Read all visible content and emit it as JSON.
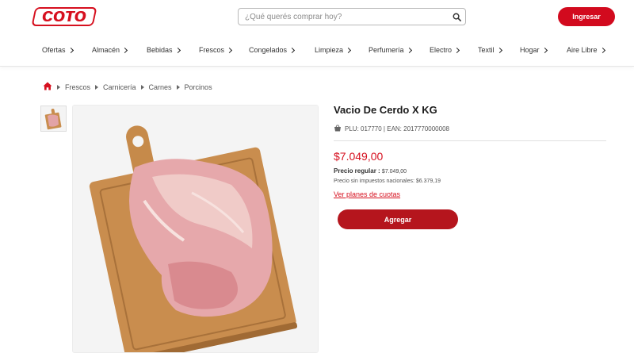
{
  "header": {
    "logo_text": "COTO",
    "search_placeholder": "¿Qué querés comprar hoy?",
    "login_label": "Ingresar",
    "brand_color": "#d6101f"
  },
  "nav": {
    "items": [
      {
        "label": "Ofertas"
      },
      {
        "label": "Almacén"
      },
      {
        "label": "Bebidas"
      },
      {
        "label": "Frescos"
      },
      {
        "label": "Congelados"
      },
      {
        "label": "Limpieza"
      },
      {
        "label": "Perfumería"
      },
      {
        "label": "Electro"
      },
      {
        "label": "Textil"
      },
      {
        "label": "Hogar"
      },
      {
        "label": "Aire Libre"
      }
    ]
  },
  "breadcrumb": {
    "items": [
      "Frescos",
      "Carnicería",
      "Carnes",
      "Porcinos"
    ]
  },
  "product": {
    "title": "Vacio De Cerdo X KG",
    "codes": "PLU: 017770 | EAN: 2017770000008",
    "price": "$7.049,00",
    "regular_label": "Precio regular :",
    "regular_value": "$7.049,00",
    "tax_text": "Precio sin impuestos nacionales: $6.379,19",
    "installments_link": "Ver planes de cuotas",
    "add_button": "Agregar",
    "image_icon": "pork-flank-on-cutting-board"
  }
}
